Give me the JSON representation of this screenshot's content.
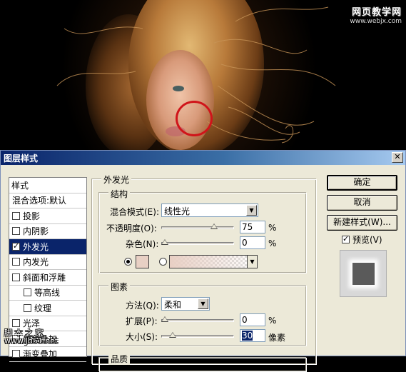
{
  "photo_watermark": {
    "line1": "网页教学网",
    "line2": "www.webjx.com"
  },
  "dialog": {
    "title": "图层样式",
    "close_glyph": "✕"
  },
  "styles_list": {
    "header": "样式",
    "blend_options": "混合选项:默认",
    "items": [
      {
        "label": "投影",
        "checked": false,
        "selected": false,
        "indent": false
      },
      {
        "label": "内阴影",
        "checked": false,
        "selected": false,
        "indent": false
      },
      {
        "label": "外发光",
        "checked": true,
        "selected": true,
        "indent": false
      },
      {
        "label": "内发光",
        "checked": false,
        "selected": false,
        "indent": false
      },
      {
        "label": "斜面和浮雕",
        "checked": false,
        "selected": false,
        "indent": false
      },
      {
        "label": "等高线",
        "checked": false,
        "selected": false,
        "indent": true
      },
      {
        "label": "纹理",
        "checked": false,
        "selected": false,
        "indent": true
      },
      {
        "label": "光泽",
        "checked": false,
        "selected": false,
        "indent": false
      },
      {
        "label": "颜色叠加",
        "checked": false,
        "selected": false,
        "indent": false
      },
      {
        "label": "渐变叠加",
        "checked": false,
        "selected": false,
        "indent": false
      }
    ]
  },
  "outer_glow": {
    "title": "外发光",
    "structure": {
      "title": "结构",
      "blend_mode_label": "混合模式(E):",
      "blend_mode_value": "线性光",
      "opacity_label": "不透明度(O):",
      "opacity_value": "75",
      "opacity_fraction": 0.75,
      "noise_label": "杂色(N):",
      "noise_value": "0",
      "noise_fraction": 0,
      "unit_percent": "%",
      "glow_color": "#e8d0c4"
    },
    "elements": {
      "title": "图素",
      "technique_label": "方法(Q):",
      "technique_value": "柔和",
      "spread_label": "扩展(P):",
      "spread_value": "0",
      "spread_fraction": 0,
      "size_label": "大小(S):",
      "size_value": "30",
      "size_fraction": 0.12,
      "unit_percent": "%",
      "unit_pixels": "像素"
    },
    "quality": {
      "title": "品质"
    }
  },
  "buttons": {
    "ok": "确定",
    "cancel": "取消",
    "new_style": "新建样式(W)...",
    "preview_label": "预览(V)",
    "preview_checked": true
  },
  "bottom_watermark": {
    "line1": "脚 本 之 家",
    "line2": "www.Jb51.net"
  }
}
